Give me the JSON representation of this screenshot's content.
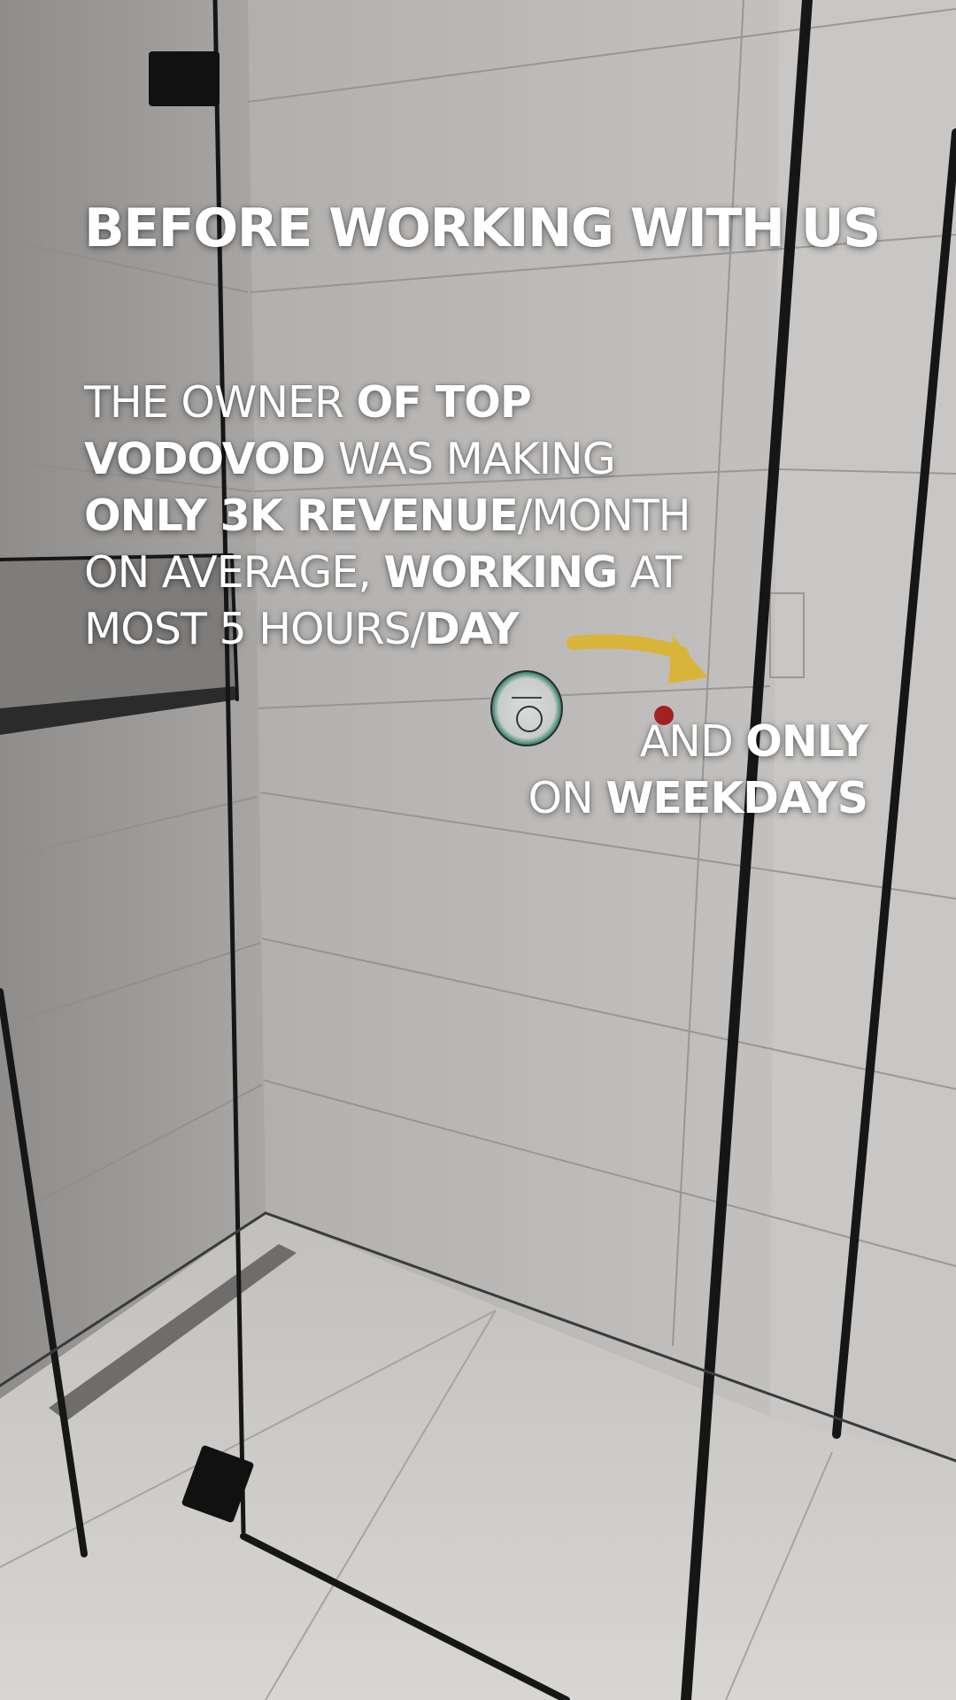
{
  "title": "BEFORE WORKING WITH US",
  "body": {
    "line1": {
      "t1": "THE OWNER ",
      "t2": "OF TOP"
    },
    "line2": {
      "t1": "VODOVOD",
      "t2": " WAS MAKING"
    },
    "line3": {
      "t1": "ONLY 3K REVENUE",
      "t2": "/MONTH"
    },
    "line4": {
      "t1": "ON AVERAGE, ",
      "t2": "WORKING",
      "t3": " AT"
    },
    "line5": {
      "t1": "MOST 5 HOURS/",
      "t2": "DAY"
    }
  },
  "side": {
    "line1": {
      "t1": "AND ",
      "t2": "ONLY"
    },
    "line2": {
      "t1": "ON ",
      "t2": "WEEKDAYS"
    }
  },
  "colors": {
    "arrow": "#d8b53a",
    "text": "#ffffff",
    "tile_wall": "#b9b7b5",
    "tile_floor": "#cfcdca",
    "frame": "#151515"
  }
}
